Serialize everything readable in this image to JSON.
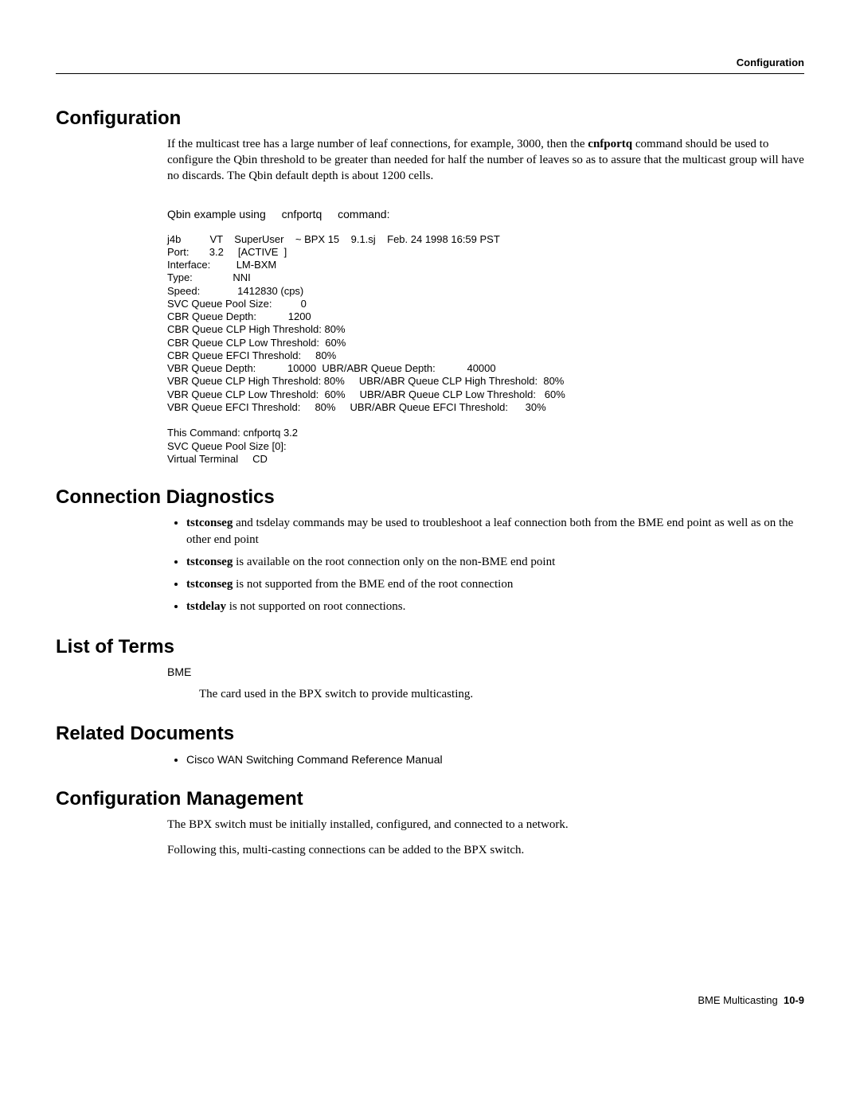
{
  "header": {
    "right": "Configuration"
  },
  "sections": {
    "config": {
      "title": "Configuration",
      "para": "If the multicast tree has a large number of leaf connections, for example, 3000, then the ",
      "para_bold": "cnfportq",
      "para2": " command should be used to configure the Qbin threshold to be greater than needed for half the number of leaves so as to assure that the multicast group will have no discards. The Qbin default depth is about 1200 cells.",
      "example_pre": "Qbin example using",
      "example_cmd": "cnfportq",
      "example_post": "command:",
      "code": "j4b          VT    SuperUser    ~ BPX 15    9.1.sj    Feb. 24 1998 16:59 PST\nPort:       3.2     [ACTIVE  ]\nInterface:         LM-BXM\nType:              NNI\nSpeed:             1412830 (cps)\nSVC Queue Pool Size:          0\nCBR Queue Depth:           1200\nCBR Queue CLP High Threshold: 80%\nCBR Queue CLP Low Threshold:  60%\nCBR Queue EFCI Threshold:     80%\nVBR Queue Depth:           10000  UBR/ABR Queue Depth:           40000\nVBR Queue CLP High Threshold: 80%     UBR/ABR Queue CLP High Threshold:  80%\nVBR Queue CLP Low Threshold:  60%     UBR/ABR Queue CLP Low Threshold:   60%\nVBR Queue EFCI Threshold:     80%     UBR/ABR Queue EFCI Threshold:      30%\n\nThis Command: cnfportq 3.2\nSVC Queue Pool Size [0]:\nVirtual Terminal     CD"
    },
    "diag": {
      "title": "Connection Diagnostics",
      "b1_bold": "tstconseg",
      "b1_rest": " and tsdelay commands may be used to troubleshoot a leaf connection both from the BME end point as well as on the other end point",
      "b2_bold": "tstconseg",
      "b2_rest": " is available on the root connection only on the non-BME end point",
      "b3_bold": "tstconseg",
      "b3_rest": " is not supported from the BME end of the root connection",
      "b4_bold": "tstdelay",
      "b4_rest": " is not supported on root connections."
    },
    "terms": {
      "title": "List of Terms",
      "term": "BME",
      "def": "The card used in the BPX switch to provide multicasting."
    },
    "related": {
      "title": "Related Documents",
      "item": "Cisco WAN Switching Command Reference Manual"
    },
    "mgmt": {
      "title": "Configuration Management",
      "p1": "The BPX switch must be initially installed, configured, and connected to a network.",
      "p2": "Following this, multi-casting connections can be added to the BPX switch."
    }
  },
  "footer": {
    "text": "BME Multicasting",
    "page": "10-9"
  }
}
